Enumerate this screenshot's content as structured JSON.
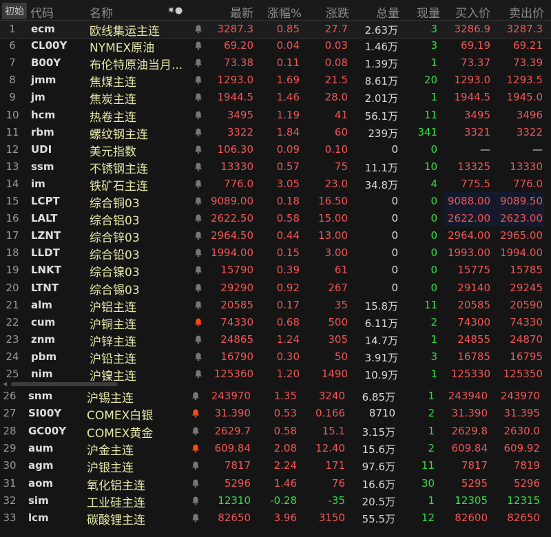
{
  "header": {
    "init": "初始",
    "code": "代码",
    "name": "名称",
    "icons": "✷●",
    "last": "最新",
    "pct": "涨幅%",
    "chg": "涨跌",
    "vol": "总量",
    "cur": "现量",
    "bid": "买入价",
    "ask": "卖出价"
  },
  "colors": {
    "up": "#f25555",
    "down": "#33dd44",
    "bell_active": "#ff4a10",
    "bell": "#777777"
  },
  "rows_top": [
    {
      "i": "1",
      "code": "ecm",
      "name": "欧线集运主连",
      "bell": false,
      "last": "3287.3",
      "pct": "0.85",
      "chg": "27.7",
      "vol": "2.63万",
      "cur": "3",
      "bid": "3286.9",
      "ask": "3287.3",
      "dir": "up"
    },
    {
      "i": "6",
      "code": "CL00Y",
      "name": "NYMEX原油",
      "bell": false,
      "last": "69.20",
      "pct": "0.04",
      "chg": "0.03",
      "vol": "1.46万",
      "cur": "3",
      "bid": "69.19",
      "ask": "69.21",
      "dir": "up"
    },
    {
      "i": "7",
      "code": "B00Y",
      "name": "布伦特原油当月...",
      "bell": false,
      "last": "73.38",
      "pct": "0.11",
      "chg": "0.08",
      "vol": "1.39万",
      "cur": "1",
      "bid": "73.37",
      "ask": "73.39",
      "dir": "up"
    },
    {
      "i": "8",
      "code": "jmm",
      "name": "焦煤主连",
      "bell": false,
      "last": "1293.0",
      "pct": "1.69",
      "chg": "21.5",
      "vol": "8.61万",
      "cur": "20",
      "bid": "1293.0",
      "ask": "1293.5",
      "dir": "up"
    },
    {
      "i": "9",
      "code": "jm",
      "name": "焦炭主连",
      "bell": false,
      "last": "1944.5",
      "pct": "1.46",
      "chg": "28.0",
      "vol": "2.01万",
      "cur": "1",
      "bid": "1944.5",
      "ask": "1945.0",
      "dir": "up"
    },
    {
      "i": "10",
      "code": "hcm",
      "name": "热卷主连",
      "bell": false,
      "last": "3495",
      "pct": "1.19",
      "chg": "41",
      "vol": "56.1万",
      "cur": "11",
      "bid": "3495",
      "ask": "3496",
      "dir": "up"
    },
    {
      "i": "11",
      "code": "rbm",
      "name": "螺纹钢主连",
      "bell": false,
      "last": "3322",
      "pct": "1.84",
      "chg": "60",
      "vol": "239万",
      "cur": "341",
      "bid": "3321",
      "ask": "3322",
      "dir": "up"
    },
    {
      "i": "12",
      "code": "UDI",
      "name": "美元指数",
      "bell": false,
      "last": "106.30",
      "pct": "0.09",
      "chg": "0.10",
      "vol": "0",
      "cur": "0",
      "bid": "—",
      "ask": "—",
      "dir": "up"
    },
    {
      "i": "13",
      "code": "ssm",
      "name": "不锈钢主连",
      "bell": false,
      "last": "13330",
      "pct": "0.57",
      "chg": "75",
      "vol": "11.1万",
      "cur": "10",
      "bid": "13325",
      "ask": "13330",
      "dir": "up"
    },
    {
      "i": "14",
      "code": "im",
      "name": "铁矿石主连",
      "bell": false,
      "last": "776.0",
      "pct": "3.05",
      "chg": "23.0",
      "vol": "34.8万",
      "cur": "4",
      "bid": "775.5",
      "ask": "776.0",
      "dir": "up"
    },
    {
      "i": "15",
      "code": "LCPT",
      "name": "综合铜03",
      "bell": false,
      "last": "9089.00",
      "pct": "0.18",
      "chg": "16.50",
      "vol": "0",
      "cur": "0",
      "bid": "9088.00",
      "ask": "9089.50",
      "dir": "up"
    },
    {
      "i": "16",
      "code": "LALT",
      "name": "综合铝03",
      "bell": false,
      "last": "2622.50",
      "pct": "0.58",
      "chg": "15.00",
      "vol": "0",
      "cur": "0",
      "bid": "2622.00",
      "ask": "2623.00",
      "dir": "up"
    },
    {
      "i": "17",
      "code": "LZNT",
      "name": "综合锌03",
      "bell": false,
      "last": "2964.50",
      "pct": "0.44",
      "chg": "13.00",
      "vol": "0",
      "cur": "0",
      "bid": "2964.00",
      "ask": "2965.00",
      "dir": "up"
    },
    {
      "i": "18",
      "code": "LLDT",
      "name": "综合铅03",
      "bell": false,
      "last": "1994.00",
      "pct": "0.15",
      "chg": "3.00",
      "vol": "0",
      "cur": "0",
      "bid": "1993.00",
      "ask": "1994.00",
      "dir": "up"
    },
    {
      "i": "19",
      "code": "LNKT",
      "name": "综合镍03",
      "bell": false,
      "last": "15790",
      "pct": "0.39",
      "chg": "61",
      "vol": "0",
      "cur": "0",
      "bid": "15775",
      "ask": "15785",
      "dir": "up"
    },
    {
      "i": "20",
      "code": "LTNT",
      "name": "综合锡03",
      "bell": false,
      "last": "29290",
      "pct": "0.92",
      "chg": "267",
      "vol": "0",
      "cur": "0",
      "bid": "29140",
      "ask": "29245",
      "dir": "up"
    },
    {
      "i": "21",
      "code": "alm",
      "name": "沪铝主连",
      "bell": false,
      "last": "20585",
      "pct": "0.17",
      "chg": "35",
      "vol": "15.8万",
      "cur": "11",
      "bid": "20585",
      "ask": "20590",
      "dir": "up"
    },
    {
      "i": "22",
      "code": "cum",
      "name": "沪铜主连",
      "bell": true,
      "last": "74330",
      "pct": "0.68",
      "chg": "500",
      "vol": "6.11万",
      "cur": "2",
      "bid": "74300",
      "ask": "74330",
      "dir": "up"
    },
    {
      "i": "23",
      "code": "znm",
      "name": "沪锌主连",
      "bell": false,
      "last": "24865",
      "pct": "1.24",
      "chg": "305",
      "vol": "14.7万",
      "cur": "1",
      "bid": "24855",
      "ask": "24870",
      "dir": "up"
    },
    {
      "i": "24",
      "code": "pbm",
      "name": "沪铅主连",
      "bell": false,
      "last": "16790",
      "pct": "0.30",
      "chg": "50",
      "vol": "3.91万",
      "cur": "3",
      "bid": "16785",
      "ask": "16795",
      "dir": "up"
    },
    {
      "i": "25",
      "code": "nim",
      "name": "沪镍主连",
      "bell": false,
      "last": "125360",
      "pct": "1.20",
      "chg": "1490",
      "vol": "10.9万",
      "cur": "1",
      "bid": "125330",
      "ask": "125350",
      "dir": "up"
    }
  ],
  "rows_bottom": [
    {
      "i": "26",
      "code": "snm",
      "name": "沪锡主连",
      "bell": false,
      "last": "243970",
      "pct": "1.35",
      "chg": "3240",
      "vol": "6.85万",
      "cur": "1",
      "bid": "243940",
      "ask": "243970",
      "dir": "up"
    },
    {
      "i": "27",
      "code": "SI00Y",
      "name": "COMEX白银",
      "bell": true,
      "last": "31.390",
      "pct": "0.53",
      "chg": "0.166",
      "vol": "8710",
      "cur": "2",
      "bid": "31.390",
      "ask": "31.395",
      "dir": "up"
    },
    {
      "i": "28",
      "code": "GC00Y",
      "name": "COMEX黄金",
      "bell": false,
      "last": "2629.7",
      "pct": "0.58",
      "chg": "15.1",
      "vol": "3.15万",
      "cur": "1",
      "bid": "2629.8",
      "ask": "2630.0",
      "dir": "up"
    },
    {
      "i": "29",
      "code": "aum",
      "name": "沪金主连",
      "bell": true,
      "last": "609.84",
      "pct": "2.08",
      "chg": "12.40",
      "vol": "15.6万",
      "cur": "2",
      "bid": "609.84",
      "ask": "609.92",
      "dir": "up"
    },
    {
      "i": "30",
      "code": "agm",
      "name": "沪银主连",
      "bell": false,
      "last": "7817",
      "pct": "2.24",
      "chg": "171",
      "vol": "97.6万",
      "cur": "11",
      "bid": "7817",
      "ask": "7819",
      "dir": "up"
    },
    {
      "i": "31",
      "code": "aom",
      "name": "氧化铝主连",
      "bell": false,
      "last": "5296",
      "pct": "1.46",
      "chg": "76",
      "vol": "16.6万",
      "cur": "30",
      "bid": "5295",
      "ask": "5296",
      "dir": "up"
    },
    {
      "i": "32",
      "code": "sim",
      "name": "工业硅主连",
      "bell": false,
      "last": "12310",
      "pct": "-0.28",
      "chg": "-35",
      "vol": "20.5万",
      "cur": "1",
      "bid": "12305",
      "ask": "12315",
      "dir": "down"
    },
    {
      "i": "33",
      "code": "lcm",
      "name": "碳酸锂主连",
      "bell": false,
      "last": "82650",
      "pct": "3.96",
      "chg": "3150",
      "vol": "55.5万",
      "cur": "12",
      "bid": "82600",
      "ask": "82650",
      "dir": "up"
    }
  ]
}
